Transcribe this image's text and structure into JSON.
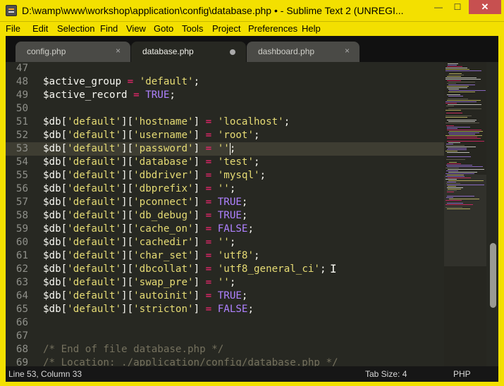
{
  "window": {
    "title": "D:\\wamp\\www\\workshop\\application\\config\\database.php • - Sublime Text 2 (UNREGI...",
    "minimize": "—",
    "maximize": "☐",
    "close": "✕"
  },
  "menu": [
    "File",
    "Edit",
    "Selection",
    "Find",
    "View",
    "Goto",
    "Tools",
    "Project",
    "Preferences",
    "Help"
  ],
  "tabs": [
    {
      "label": "config.php",
      "state": "close",
      "close": "×"
    },
    {
      "label": "database.php",
      "state": "dirty"
    },
    {
      "label": "dashboard.php",
      "state": "close",
      "close": "×"
    }
  ],
  "active_tab": "database.php",
  "editor": {
    "current_line": 53,
    "lines": [
      {
        "n": "47",
        "tokens": []
      },
      {
        "n": "48",
        "tokens": [
          [
            "var",
            "$active_group "
          ],
          [
            "op",
            "="
          ],
          [
            "var",
            " "
          ],
          [
            "str",
            "'default'"
          ],
          [
            "var",
            ";"
          ]
        ]
      },
      {
        "n": "49",
        "tokens": [
          [
            "var",
            "$active_record "
          ],
          [
            "op",
            "="
          ],
          [
            "var",
            " "
          ],
          [
            "const",
            "TRUE"
          ],
          [
            "var",
            ";"
          ]
        ]
      },
      {
        "n": "50",
        "tokens": []
      },
      {
        "n": "51",
        "tokens": [
          [
            "var",
            "$db["
          ],
          [
            "str",
            "'default'"
          ],
          [
            "var",
            "]["
          ],
          [
            "str",
            "'hostname'"
          ],
          [
            "var",
            "] "
          ],
          [
            "op",
            "="
          ],
          [
            "var",
            " "
          ],
          [
            "str",
            "'localhost'"
          ],
          [
            "var",
            ";"
          ]
        ]
      },
      {
        "n": "52",
        "tokens": [
          [
            "var",
            "$db["
          ],
          [
            "str",
            "'default'"
          ],
          [
            "var",
            "]["
          ],
          [
            "str",
            "'username'"
          ],
          [
            "var",
            "] "
          ],
          [
            "op",
            "="
          ],
          [
            "var",
            " "
          ],
          [
            "str",
            "'root'"
          ],
          [
            "var",
            ";"
          ]
        ]
      },
      {
        "n": "53",
        "tokens": [
          [
            "var",
            "$db["
          ],
          [
            "str",
            "'default'"
          ],
          [
            "var",
            "]["
          ],
          [
            "str",
            "'password'"
          ],
          [
            "var",
            "] "
          ],
          [
            "op",
            "="
          ],
          [
            "var",
            " "
          ],
          [
            "str",
            "''"
          ],
          [
            "var",
            ";"
          ]
        ]
      },
      {
        "n": "54",
        "tokens": [
          [
            "var",
            "$db["
          ],
          [
            "str",
            "'default'"
          ],
          [
            "var",
            "]["
          ],
          [
            "str",
            "'database'"
          ],
          [
            "var",
            "] "
          ],
          [
            "op",
            "="
          ],
          [
            "var",
            " "
          ],
          [
            "str",
            "'test'"
          ],
          [
            "var",
            ";"
          ]
        ]
      },
      {
        "n": "55",
        "tokens": [
          [
            "var",
            "$db["
          ],
          [
            "str",
            "'default'"
          ],
          [
            "var",
            "]["
          ],
          [
            "str",
            "'dbdriver'"
          ],
          [
            "var",
            "] "
          ],
          [
            "op",
            "="
          ],
          [
            "var",
            " "
          ],
          [
            "str",
            "'mysql'"
          ],
          [
            "var",
            ";"
          ]
        ]
      },
      {
        "n": "56",
        "tokens": [
          [
            "var",
            "$db["
          ],
          [
            "str",
            "'default'"
          ],
          [
            "var",
            "]["
          ],
          [
            "str",
            "'dbprefix'"
          ],
          [
            "var",
            "] "
          ],
          [
            "op",
            "="
          ],
          [
            "var",
            " "
          ],
          [
            "str",
            "''"
          ],
          [
            "var",
            ";"
          ]
        ]
      },
      {
        "n": "57",
        "tokens": [
          [
            "var",
            "$db["
          ],
          [
            "str",
            "'default'"
          ],
          [
            "var",
            "]["
          ],
          [
            "str",
            "'pconnect'"
          ],
          [
            "var",
            "] "
          ],
          [
            "op",
            "="
          ],
          [
            "var",
            " "
          ],
          [
            "const",
            "TRUE"
          ],
          [
            "var",
            ";"
          ]
        ]
      },
      {
        "n": "58",
        "tokens": [
          [
            "var",
            "$db["
          ],
          [
            "str",
            "'default'"
          ],
          [
            "var",
            "]["
          ],
          [
            "str",
            "'db_debug'"
          ],
          [
            "var",
            "] "
          ],
          [
            "op",
            "="
          ],
          [
            "var",
            " "
          ],
          [
            "const",
            "TRUE"
          ],
          [
            "var",
            ";"
          ]
        ]
      },
      {
        "n": "59",
        "tokens": [
          [
            "var",
            "$db["
          ],
          [
            "str",
            "'default'"
          ],
          [
            "var",
            "]["
          ],
          [
            "str",
            "'cache_on'"
          ],
          [
            "var",
            "] "
          ],
          [
            "op",
            "="
          ],
          [
            "var",
            " "
          ],
          [
            "const",
            "FALSE"
          ],
          [
            "var",
            ";"
          ]
        ]
      },
      {
        "n": "60",
        "tokens": [
          [
            "var",
            "$db["
          ],
          [
            "str",
            "'default'"
          ],
          [
            "var",
            "]["
          ],
          [
            "str",
            "'cachedir'"
          ],
          [
            "var",
            "] "
          ],
          [
            "op",
            "="
          ],
          [
            "var",
            " "
          ],
          [
            "str",
            "''"
          ],
          [
            "var",
            ";"
          ]
        ]
      },
      {
        "n": "61",
        "tokens": [
          [
            "var",
            "$db["
          ],
          [
            "str",
            "'default'"
          ],
          [
            "var",
            "]["
          ],
          [
            "str",
            "'char_set'"
          ],
          [
            "var",
            "] "
          ],
          [
            "op",
            "="
          ],
          [
            "var",
            " "
          ],
          [
            "str",
            "'utf8'"
          ],
          [
            "var",
            ";"
          ]
        ]
      },
      {
        "n": "62",
        "tokens": [
          [
            "var",
            "$db["
          ],
          [
            "str",
            "'default'"
          ],
          [
            "var",
            "]["
          ],
          [
            "str",
            "'dbcollat'"
          ],
          [
            "var",
            "] "
          ],
          [
            "op",
            "="
          ],
          [
            "var",
            " "
          ],
          [
            "str",
            "'utf8_general_ci'"
          ],
          [
            "var",
            ";"
          ]
        ]
      },
      {
        "n": "63",
        "tokens": [
          [
            "var",
            "$db["
          ],
          [
            "str",
            "'default'"
          ],
          [
            "var",
            "]["
          ],
          [
            "str",
            "'swap_pre'"
          ],
          [
            "var",
            "] "
          ],
          [
            "op",
            "="
          ],
          [
            "var",
            " "
          ],
          [
            "str",
            "''"
          ],
          [
            "var",
            ";"
          ]
        ]
      },
      {
        "n": "64",
        "tokens": [
          [
            "var",
            "$db["
          ],
          [
            "str",
            "'default'"
          ],
          [
            "var",
            "]["
          ],
          [
            "str",
            "'autoinit'"
          ],
          [
            "var",
            "] "
          ],
          [
            "op",
            "="
          ],
          [
            "var",
            " "
          ],
          [
            "const",
            "TRUE"
          ],
          [
            "var",
            ";"
          ]
        ]
      },
      {
        "n": "65",
        "tokens": [
          [
            "var",
            "$db["
          ],
          [
            "str",
            "'default'"
          ],
          [
            "var",
            "]["
          ],
          [
            "str",
            "'stricton'"
          ],
          [
            "var",
            "] "
          ],
          [
            "op",
            "="
          ],
          [
            "var",
            " "
          ],
          [
            "const",
            "FALSE"
          ],
          [
            "var",
            ";"
          ]
        ]
      },
      {
        "n": "66",
        "tokens": []
      },
      {
        "n": "67",
        "tokens": []
      },
      {
        "n": "68",
        "tokens": [
          [
            "cmt",
            "/* End of file database.php */"
          ]
        ]
      },
      {
        "n": "69",
        "tokens": [
          [
            "cmt",
            "/* Location: ./application/config/database.php */"
          ]
        ]
      }
    ]
  },
  "status": {
    "position": "Line 53, Column 33",
    "tab_size": "Tab Size: 4",
    "syntax": "PHP"
  },
  "colors": {
    "title_bar": "#f3e000",
    "editor_bg": "#272822",
    "keyword": "#f92672",
    "string": "#e6db74",
    "constant": "#ae81ff",
    "comment": "#75715e"
  }
}
